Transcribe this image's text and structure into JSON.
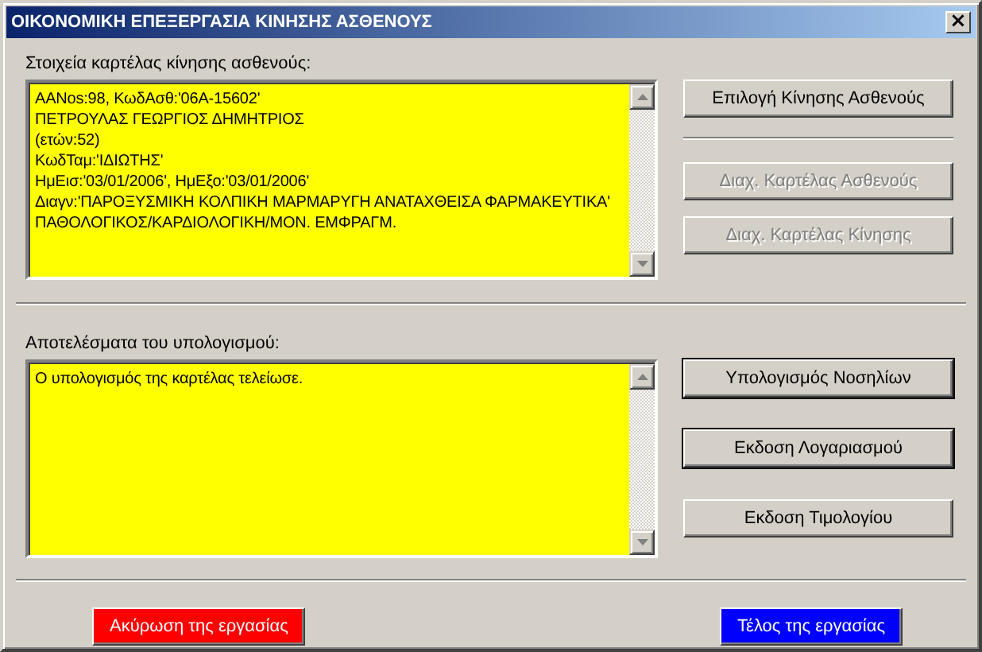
{
  "window": {
    "title": "ΟΙΚΟΝΟΜΙΚΗ ΕΠΕΞΕΡΓΑΣΙΑ ΚΙΝΗΣΗΣ ΑΣΘΕΝΟΥΣ",
    "close": "×"
  },
  "patient_section": {
    "label": "Στοιχεία καρτέλας κίνησης ασθενούς:",
    "lines": [
      "AANos:98, ΚωδΑσθ:'06A-15602'",
      "ΠΕΤΡΟΥΛΑΣ ΓΕΩΡΓΙΟΣ ΔΗΜΗΤΡΙΟΣ",
      "(ετών:52)",
      "ΚωδΤαμ:'ΙΔΙΩΤΗΣ'",
      "ΗμΕισ:'03/01/2006', ΗμΕξο:'03/01/2006'",
      "Διαγν:'ΠΑΡΟΞΥΣΜΙΚΗ ΚΟΛΠΙΚΗ ΜΑΡΜΑΡΥΓΗ ΑΝΑΤΑΧΘΕΙΣΑ ΦΑΡΜΑΚΕΥΤΙΚΑ'",
      "ΠΑΘΟΛΟΓΙΚΟΣ/ΚΑΡΔΙΟΛΟΓΙΚΗ/ΜΟΝ. ΕΜΦΡΑΓΜ."
    ],
    "primary_button": {
      "label": "Επιλογή Κίνησης Ασθενούς",
      "disabled": false
    },
    "buttons": [
      {
        "label": "Διαχ. Καρτέλας Ασθενούς",
        "disabled": true
      },
      {
        "label": "Διαχ. Καρτέλας Κίνησης",
        "disabled": true
      }
    ]
  },
  "results_section": {
    "label": "Αποτελέσματα του υπολογισμού:",
    "lines": [
      "Ο υπολογισμός της καρτέλας τελείωσε."
    ],
    "buttons": [
      {
        "label": "Υπολογισμός Νοσηλίων",
        "disabled": false,
        "default": true
      },
      {
        "label": "Εκδοση Λογαριασμού",
        "disabled": false,
        "default": true
      },
      {
        "label": "Εκδοση Τιμολογίου",
        "disabled": false,
        "default": false
      }
    ]
  },
  "footer_buttons": [
    {
      "label": "Ακύρωση της εργασίας",
      "color": "#ff0000"
    },
    {
      "label": "Τέλος της εργασίας",
      "color": "#0000ff"
    }
  ]
}
